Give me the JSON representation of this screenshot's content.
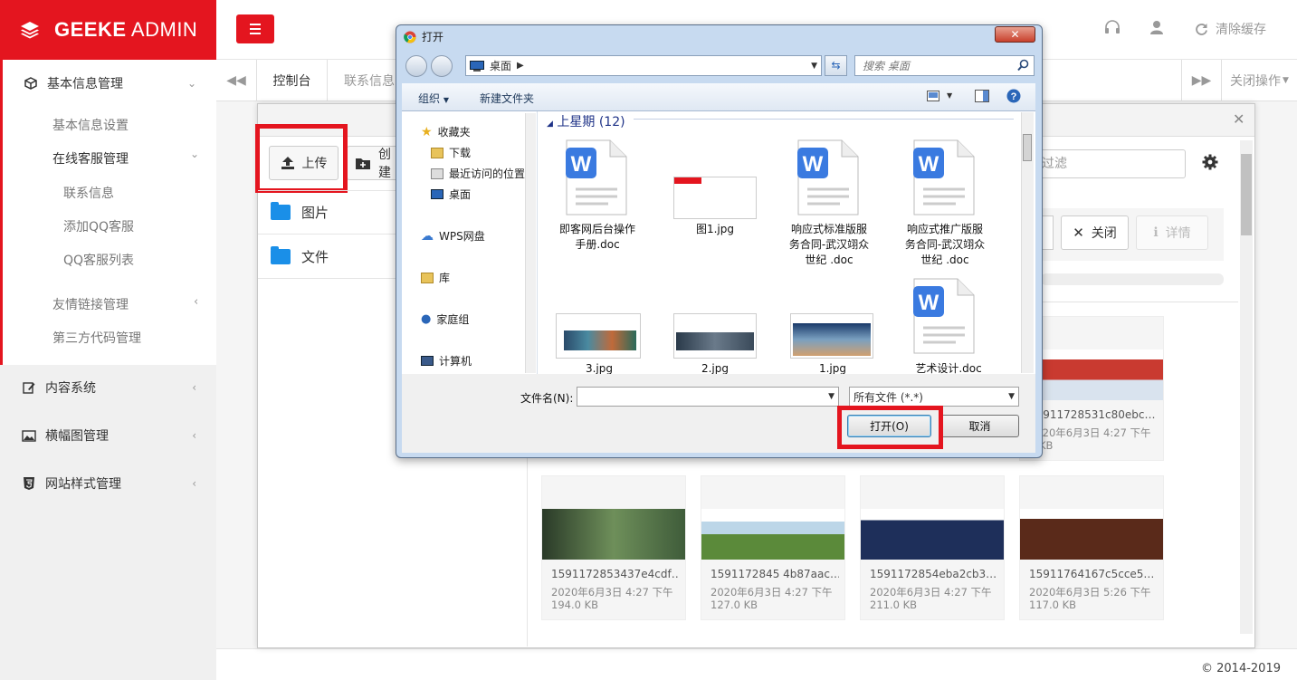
{
  "brand": {
    "name_bold": "GEEKE",
    "name_rest": " ADMIN",
    "color": "#e4151f"
  },
  "header": {
    "support": "",
    "clear_cache": "清除缓存"
  },
  "sidebar": {
    "groups": [
      {
        "label": "基本信息管理",
        "icon": "cube-icon"
      },
      {
        "label": "内容系统",
        "icon": "edit-icon"
      },
      {
        "label": "横幅图管理",
        "icon": "image-icon"
      },
      {
        "label": "网站样式管理",
        "icon": "html5-icon"
      }
    ],
    "sub": [
      "基本信息设置",
      "在线客服管理",
      "联系信息",
      "添加QQ客服",
      "QQ客服列表",
      "友情链接管理",
      "第三方代码管理"
    ]
  },
  "tabs": {
    "items": [
      "控制台",
      "联系信息"
    ],
    "close_ops": "关闭操作"
  },
  "filemanager": {
    "upload": "上传",
    "create": "创建",
    "folders": [
      "图片",
      "文件"
    ],
    "filter_placeholder": "过滤",
    "close": "关闭",
    "details": "详情",
    "cards": [
      {
        "name": "15911728531c80ebc…",
        "date": "2020年6月3日 4:27 下午",
        "size": "0 KB"
      },
      {
        "name": "1591172853437e4cdf…",
        "date": "2020年6月3日 4:27 下午",
        "size": "194.0 KB"
      },
      {
        "name": "1591172845 4b87aac…",
        "date": "2020年6月3日 4:27 下午",
        "size": "127.0 KB"
      },
      {
        "name": "1591172854eba2cb3…",
        "date": "2020年6月3日 4:27 下午",
        "size": "211.0 KB"
      },
      {
        "name": "15911764167c5cce5…",
        "date": "2020年6月3日 5:26 下午",
        "size": "117.0 KB"
      }
    ]
  },
  "dialog": {
    "title": "打开",
    "address": "桌面",
    "search_placeholder": "搜索 桌面",
    "organize": "组织",
    "new_folder": "新建文件夹",
    "nav": [
      "收藏夹",
      "下载",
      "最近访问的位置",
      "桌面",
      "WPS网盘",
      "库",
      "家庭组",
      "计算机"
    ],
    "group_header": "上星期 (12)",
    "files": [
      {
        "name": "即客网后台操作\n手册.doc",
        "type": "doc"
      },
      {
        "name": "图1.jpg",
        "type": "img"
      },
      {
        "name": "响应式标准版服\n务合同-武汉翊众\n世纪 .doc",
        "type": "doc"
      },
      {
        "name": "响应式推广版服\n务合同-武汉翊众\n世纪 .doc",
        "type": "doc"
      },
      {
        "name": "3.jpg",
        "type": "img"
      },
      {
        "name": "2.jpg",
        "type": "img"
      },
      {
        "name": "1.jpg",
        "type": "img"
      },
      {
        "name": "艺术设计.doc",
        "type": "doc"
      }
    ],
    "filename_label": "文件名(N):",
    "filename_value": "",
    "filetype": "所有文件 (*.*)",
    "open": "打开(O)",
    "cancel": "取消"
  },
  "footer": {
    "copyright": "© 2014-2019"
  }
}
